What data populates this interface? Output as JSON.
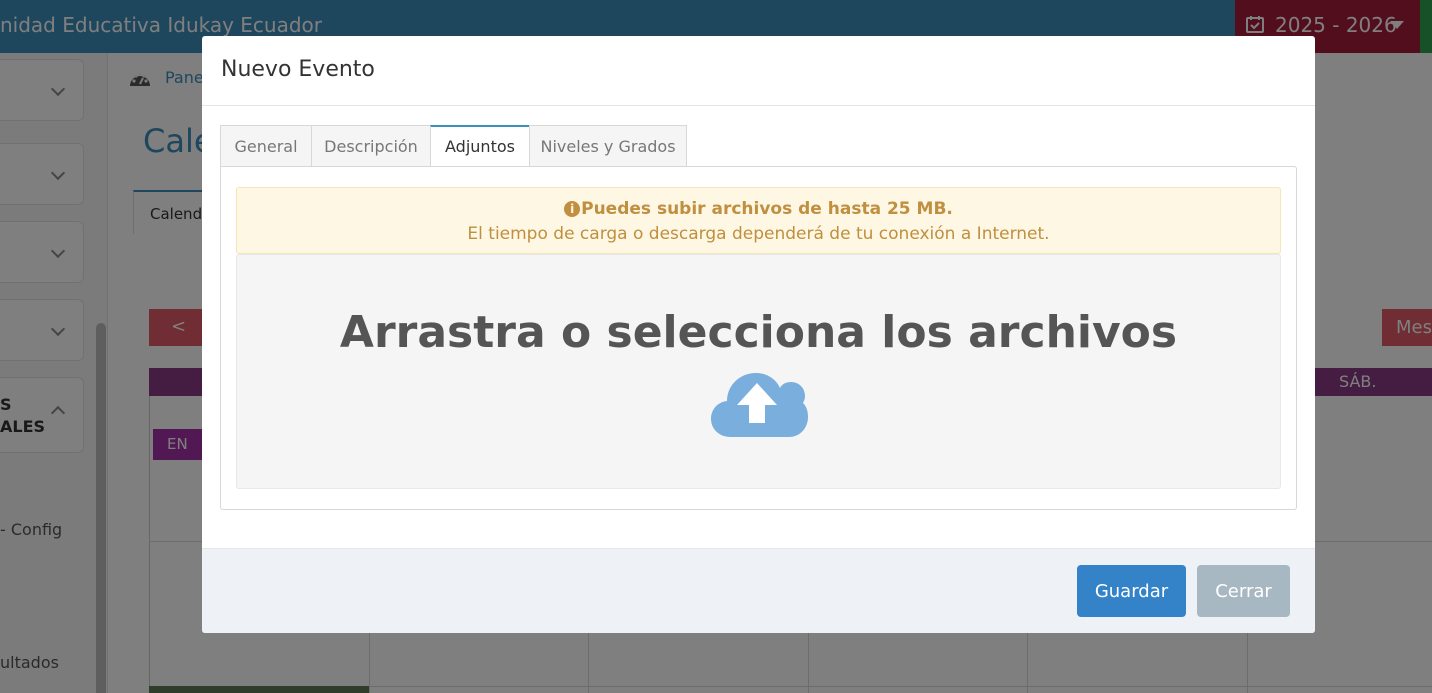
{
  "app": {
    "school_name": "nidad Educativa Idukay Ecuador",
    "year_selector": "2025 - 2026"
  },
  "sidebar": {
    "open_section_label": "S\nALES",
    "item_config": "- Config",
    "item_results": "ultados"
  },
  "page": {
    "breadcrumb": "Pane",
    "title": "Cale",
    "active_tab": "Calend",
    "prev_button": "<",
    "view_button": "Mes",
    "day_header_saturday": "SÁB.",
    "event_chip": "EN"
  },
  "modal": {
    "title": "Nuevo Evento",
    "tabs": [
      {
        "label": "General",
        "active": false
      },
      {
        "label": "Descripción",
        "active": false
      },
      {
        "label": "Adjuntos",
        "active": true
      },
      {
        "label": "Niveles y Grados",
        "active": false
      }
    ],
    "alert": {
      "line1": "Puedes subir archivos de hasta 25 MB.",
      "line2": "El tiempo de carga o descarga dependerá de tu conexión a Internet."
    },
    "dropzone": {
      "text": "Arrastra o selecciona los archivos",
      "icon": "cloud-upload-icon"
    },
    "footer": {
      "save_label": "Guardar",
      "close_label": "Cerrar"
    }
  },
  "colors": {
    "topbar": "#3d8fbd",
    "year_box": "#a61c3b",
    "save_button": "#3483c9",
    "close_button": "#a7b8c3",
    "alert_text": "#c08f3f",
    "cloud": "#7aaedc"
  }
}
